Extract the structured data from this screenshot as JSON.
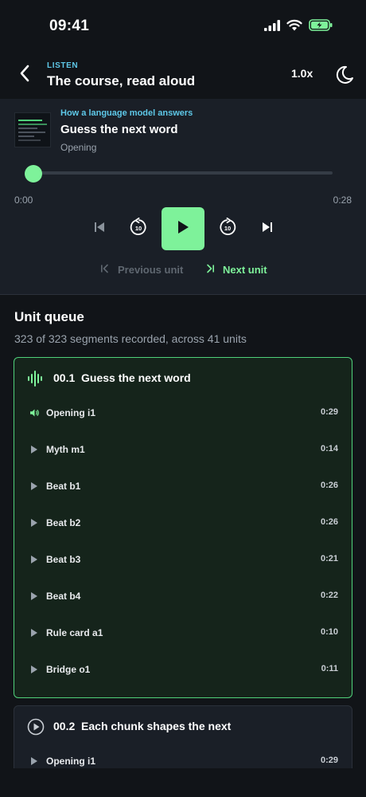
{
  "status": {
    "time": "09:41"
  },
  "header": {
    "eyebrow": "LISTEN",
    "title": "The course, read aloud",
    "speed": "1.0x"
  },
  "player": {
    "course": "How a language model answers",
    "title": "Guess the next word",
    "section": "Opening",
    "elapsed": "0:00",
    "total": "0:28",
    "progress": 0.0,
    "prev_unit": "Previous unit",
    "next_unit": "Next unit"
  },
  "queue": {
    "title": "Unit queue",
    "summary": "323 of 323 segments recorded, across 41 units",
    "units": [
      {
        "number": "00.1",
        "title": "Guess the next word",
        "active": true,
        "segments": [
          {
            "label": "Opening i1",
            "duration": "0:29",
            "playing": true
          },
          {
            "label": "Myth m1",
            "duration": "0:14"
          },
          {
            "label": "Beat b1",
            "duration": "0:26"
          },
          {
            "label": "Beat b2",
            "duration": "0:26"
          },
          {
            "label": "Beat b3",
            "duration": "0:21"
          },
          {
            "label": "Beat b4",
            "duration": "0:22"
          },
          {
            "label": "Rule card a1",
            "duration": "0:10"
          },
          {
            "label": "Bridge o1",
            "duration": "0:11"
          }
        ]
      },
      {
        "number": "00.2",
        "title": "Each chunk shapes the next",
        "active": false,
        "segments": [
          {
            "label": "Opening i1",
            "duration": "0:29"
          }
        ]
      }
    ]
  },
  "colors": {
    "accent": "#7ef29a",
    "link": "#5ec8e8",
    "background": "#111418",
    "panel": "#1a1f27"
  }
}
